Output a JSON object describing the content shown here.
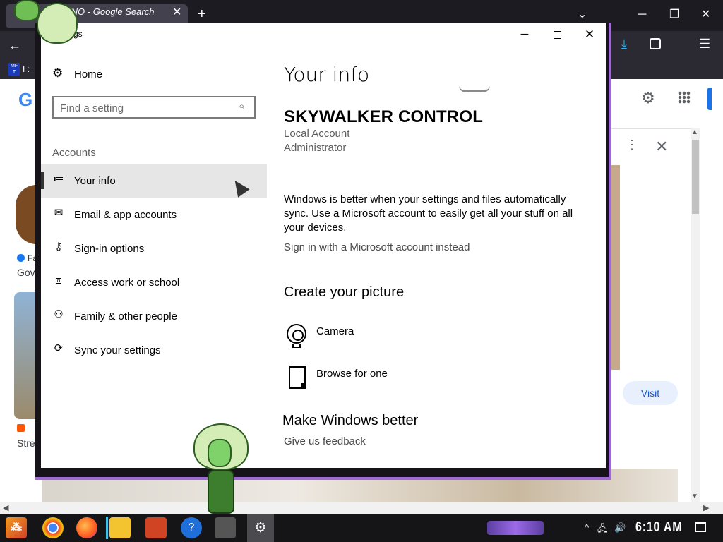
{
  "browser": {
    "tab_title": "VNO - Google Search",
    "tab_close": "✕",
    "new_tab": "+",
    "tab_list": "⌄",
    "win_min": "─",
    "win_restore": "❐",
    "win_close": "✕",
    "back": "←",
    "download": "⤓",
    "menu": "☰",
    "bookmark_icon_text": "MF T",
    "bookmark_text": "I :",
    "google_logo": "G",
    "visit": "Visit",
    "thumb_fa": "Fa",
    "thumb_gov": "Gov",
    "thumb_str": "Stre",
    "panel_close": "✕",
    "kebab": "⋮"
  },
  "settings": {
    "window_title": "gs",
    "min": "─",
    "close": "✕",
    "nav": {
      "home_icon": "⚙",
      "home": "Home",
      "search_placeholder": "Find a setting",
      "search_icon": "⌕",
      "section": "Accounts",
      "items": [
        {
          "label": "Your info",
          "icon": "person-card-icon",
          "glyph": "≔",
          "active": true
        },
        {
          "label": "Email & app accounts",
          "icon": "mail-icon",
          "glyph": "✉",
          "active": false
        },
        {
          "label": "Sign-in options",
          "icon": "key-icon",
          "glyph": "⚷",
          "active": false
        },
        {
          "label": "Access work or school",
          "icon": "briefcase-icon",
          "glyph": "⧈",
          "active": false
        },
        {
          "label": "Family & other people",
          "icon": "add-person-icon",
          "glyph": "⚇",
          "active": false
        },
        {
          "label": "Sync your settings",
          "icon": "sync-icon",
          "glyph": "⟳",
          "active": false
        }
      ]
    },
    "content": {
      "title": "Your info",
      "user_name": "SKYWALKER CONTROL",
      "account_type": "Local Account",
      "account_role": "Administrator",
      "info_text": "Windows is better when your settings and files automatically sync. Use a Microsoft account to easily get all your stuff on all your devices.",
      "ms_link": "Sign in with a Microsoft account instead",
      "picture_heading": "Create your picture",
      "camera": "Camera",
      "browse": "Browse for one",
      "better_heading": "Make Windows better",
      "feedback": "Give us feedback"
    }
  },
  "taskbar": {
    "start_glyph": "⁂",
    "help_glyph": "?",
    "settings_glyph": "⚙",
    "tray_chevron": "^",
    "tray_network": "🖧",
    "tray_volume": "🔊",
    "clock": "6:10 AM"
  },
  "colors": {
    "accent_purple": "#a06ad6",
    "active_nav": "#e6e6e6",
    "taskbar": "#151417"
  }
}
